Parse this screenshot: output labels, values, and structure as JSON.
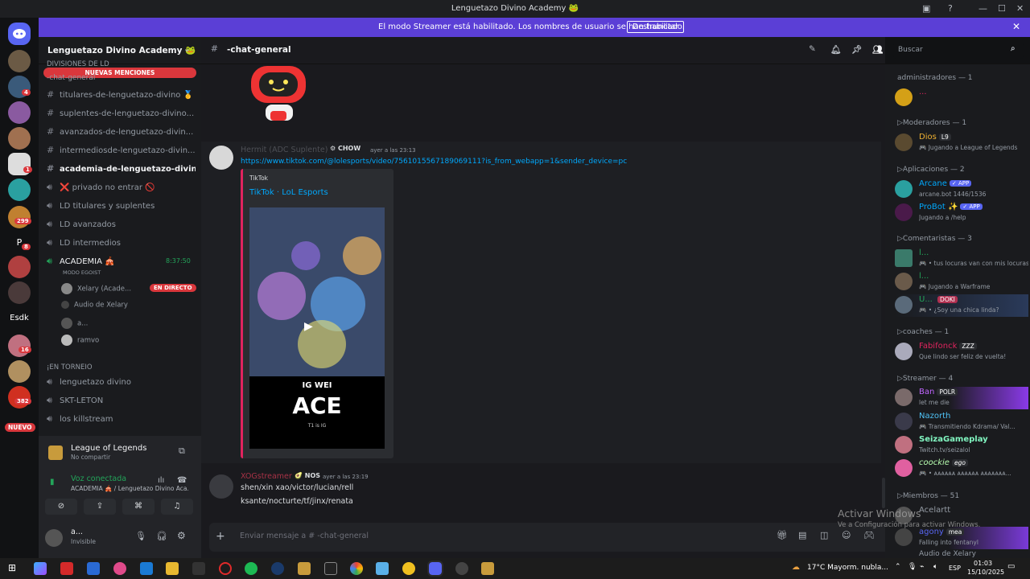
{
  "window": {
    "title": "Lenguetazo Divino Academy 🐸"
  },
  "banner": {
    "message": "El modo Streamer está habilitado. Los nombres de usuario se han truncado.",
    "button": "Deshabilitar"
  },
  "guilds": {
    "badges": [
      "4",
      "1",
      "299",
      "8",
      "16",
      "382"
    ],
    "text_items": [
      "P",
      "Esdk"
    ],
    "new_label": "NUEVO"
  },
  "server": {
    "name": "Lenguetazo Divino Academy 🐸",
    "category_top": "DIVISIONES DE LD",
    "new_mentions": "NUEVAS MENCIONES"
  },
  "channels": [
    {
      "label": "-chat-general",
      "type": "text"
    },
    {
      "label": "titulares-de-lenguetazo-divino 🥇",
      "type": "text"
    },
    {
      "label": "suplentes-de-lenguetazo-divino...",
      "type": "text"
    },
    {
      "label": "avanzados-de-lenguetazo-divin...",
      "type": "text"
    },
    {
      "label": "intermediosde-lenguetazo-divin...",
      "type": "text"
    },
    {
      "label": "academia-de-lenguetazo-divino...",
      "type": "text"
    },
    {
      "label": "❌ privado no entrar 🚫",
      "type": "voice"
    },
    {
      "label": "LD titulares y suplentes",
      "type": "voice"
    },
    {
      "label": "LD avanzados",
      "type": "voice"
    },
    {
      "label": "LD intermedios",
      "type": "voice"
    },
    {
      "label": "ACADEMIA 🎪",
      "type": "voice",
      "timer": "8:37:50",
      "sub": "MODO EGOIST"
    }
  ],
  "voice_users": [
    {
      "name": "Xelary (Acade...",
      "live": "EN DIRECTO"
    },
    {
      "name": "Audio de Xelary"
    },
    {
      "name": "a..."
    },
    {
      "name": "ramvo"
    }
  ],
  "category2": "¡EN TORNEIO",
  "channels2": [
    "lenguetazo divino",
    "SKT-LETON",
    "los killstream"
  ],
  "activity": {
    "game": "League of Legends",
    "sub": "No compartir"
  },
  "voice": {
    "status": "Voz conectada",
    "channel": "ACADEMIA 🎪 / Lenguetazo Divino Aca..."
  },
  "user": {
    "name": "a...",
    "status": "Invisible"
  },
  "chat": {
    "channel": "-chat-general",
    "search_placeholder": "Buscar",
    "input_placeholder": "Enviar mensaje a #",
    "input_channel": "-chat-general"
  },
  "messages": [
    {
      "author": "Hermit (ADC Suplente)",
      "tag": "CHOW",
      "time": "ayer a las 23:13",
      "link": "https://www.tiktok.com/@lolesports/video/7561015567189069111?is_from_webapp=1&sender_device=pc",
      "embed": {
        "provider": "TikTok",
        "title": "TikTok · LoL Esports",
        "overlay_top": "IG WEI",
        "overlay_big": "ACE",
        "overlay_small": "T1 is IG"
      }
    },
    {
      "author": "XOGstreamer",
      "tag": "NOS",
      "time": "ayer a las 23:19",
      "lines": [
        "shen/xin xao/victor/lucian/rell",
        "ksante/nocturte/tf/jinx/renata"
      ]
    }
  ],
  "members": {
    "sections": [
      {
        "title": "administradores — 1",
        "items": [
          {
            "name": "...",
            "status": "",
            "color": "#e0245e"
          }
        ]
      },
      {
        "title": "▷Moderadores — 1",
        "items": [
          {
            "name": "Dios",
            "tag": "L9",
            "status": "🎮 Jugando a League of Legends",
            "color": "#f0b232"
          }
        ]
      },
      {
        "title": "▷Aplicaciones — 2",
        "items": [
          {
            "name": "Arcane",
            "tag": "✓ APP",
            "status": "arcane.bot 1446/1536",
            "color": "#00a8fc"
          },
          {
            "name": "ProBot",
            "tag": "✓ APP",
            "status": "Jugando a /help",
            "color": "#00a8fc"
          }
        ]
      },
      {
        "title": "▷Comentaristas — 3",
        "items": [
          {
            "name": "l...",
            "status": "🎮 • tus locuras van con mis locuras",
            "color": "#23a55a"
          },
          {
            "name": "l...",
            "status": "🎮 Jugando a Warframe",
            "color": "#23a55a"
          },
          {
            "name": "U...",
            "tag": "DOKI",
            "status": "🎮 • ¿Soy una chica linda?",
            "color": "#23a55a"
          }
        ]
      },
      {
        "title": "▷coaches — 1",
        "items": [
          {
            "name": "Fabifonck",
            "tag": "ZZZ",
            "status": "Que lindo ser feliz de vuelta!",
            "color": "#e0245e"
          }
        ]
      },
      {
        "title": "▷Streamer — 4",
        "items": [
          {
            "name": "Ban",
            "tag": "POLR",
            "status": "let me die",
            "color": "#c066ff"
          },
          {
            "name": "Nazorth",
            "status": "🎮 Transmitiendo Kdrama/ Val...",
            "color": "#4fc3f7"
          },
          {
            "name": "SeizaGameplay",
            "status": "Twitch.tv/seizalol",
            "color": "#81f5c0"
          },
          {
            "name": "coockie",
            "tag": "ego",
            "status": "🎮 • ᴀᴀᴀᴀᴀᴀ ᴀᴀᴀᴀᴀᴀ ᴀᴀᴀᴀᴀᴀᴀ...",
            "color": "#b8ffb0"
          }
        ]
      },
      {
        "title": "▷Miembros — 51",
        "items": [
          {
            "name": "Acelartt",
            "status": "",
            "color": "#949ba4"
          },
          {
            "name": "agony",
            "tag": "mea",
            "status": "Falling into fentanyl",
            "color": "#5865f2"
          }
        ]
      }
    ],
    "overflow": "Audio de Xelary"
  },
  "watermark": {
    "title": "Activar Windows",
    "sub": "Ve a Configuración para activar Windows."
  },
  "taskbar": {
    "weather": "17°C  Mayorm. nubla...",
    "lang": "ESP",
    "time": "01:03",
    "date": "15/10/2025"
  },
  "colors": {
    "accent": "#5865f2",
    "banner": "#5b3fd6",
    "live": "#da373c",
    "voice_green": "#23a55a",
    "embed_bar": "#e0245e"
  }
}
